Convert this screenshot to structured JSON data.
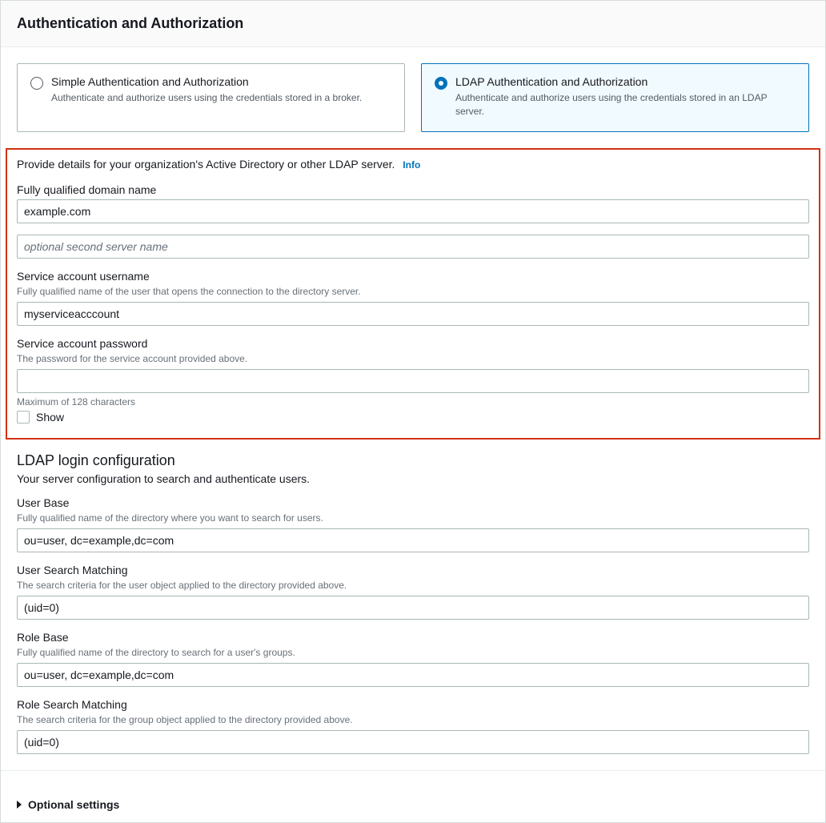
{
  "header": {
    "title": "Authentication and Authorization"
  },
  "options": {
    "simple": {
      "title": "Simple Authentication and Authorization",
      "desc": "Authenticate and authorize users using the credentials stored in a broker."
    },
    "ldap": {
      "title": "LDAP Authentication and Authorization",
      "desc": "Authenticate and authorize users using the credentials stored in an LDAP server."
    }
  },
  "ldap_details": {
    "intro": "Provide details for your organization's Active Directory or other LDAP server.",
    "info": "Info",
    "fqdn_label": "Fully qualified domain name",
    "fqdn_value": "example.com",
    "second_server_placeholder": "optional second server name",
    "svc_user_label": "Service account username",
    "svc_user_hint": "Fully qualified name of the user that opens the connection to the directory server.",
    "svc_user_value": "myserviceacccount",
    "svc_pass_label": "Service account password",
    "svc_pass_hint": "The password for the service account provided above.",
    "svc_pass_value": "",
    "maxchars": "Maximum of 128 characters",
    "show": "Show"
  },
  "login_config": {
    "title": "LDAP login configuration",
    "sub": "Your server configuration to search and authenticate users.",
    "user_base_label": "User Base",
    "user_base_hint": "Fully qualified name of the directory where you want to search for users.",
    "user_base_value": "ou=user, dc=example,dc=com",
    "user_search_label": "User Search Matching",
    "user_search_hint": "The search criteria for the user object applied to the directory provided above.",
    "user_search_value": "(uid=0)",
    "role_base_label": "Role Base",
    "role_base_hint": "Fully qualified name of the directory to search for a user's groups.",
    "role_base_value": "ou=user, dc=example,dc=com",
    "role_search_label": "Role Search Matching",
    "role_search_hint": "The search criteria for the group object applied to the directory provided above.",
    "role_search_value": "(uid=0)"
  },
  "optional": {
    "label": "Optional settings"
  }
}
